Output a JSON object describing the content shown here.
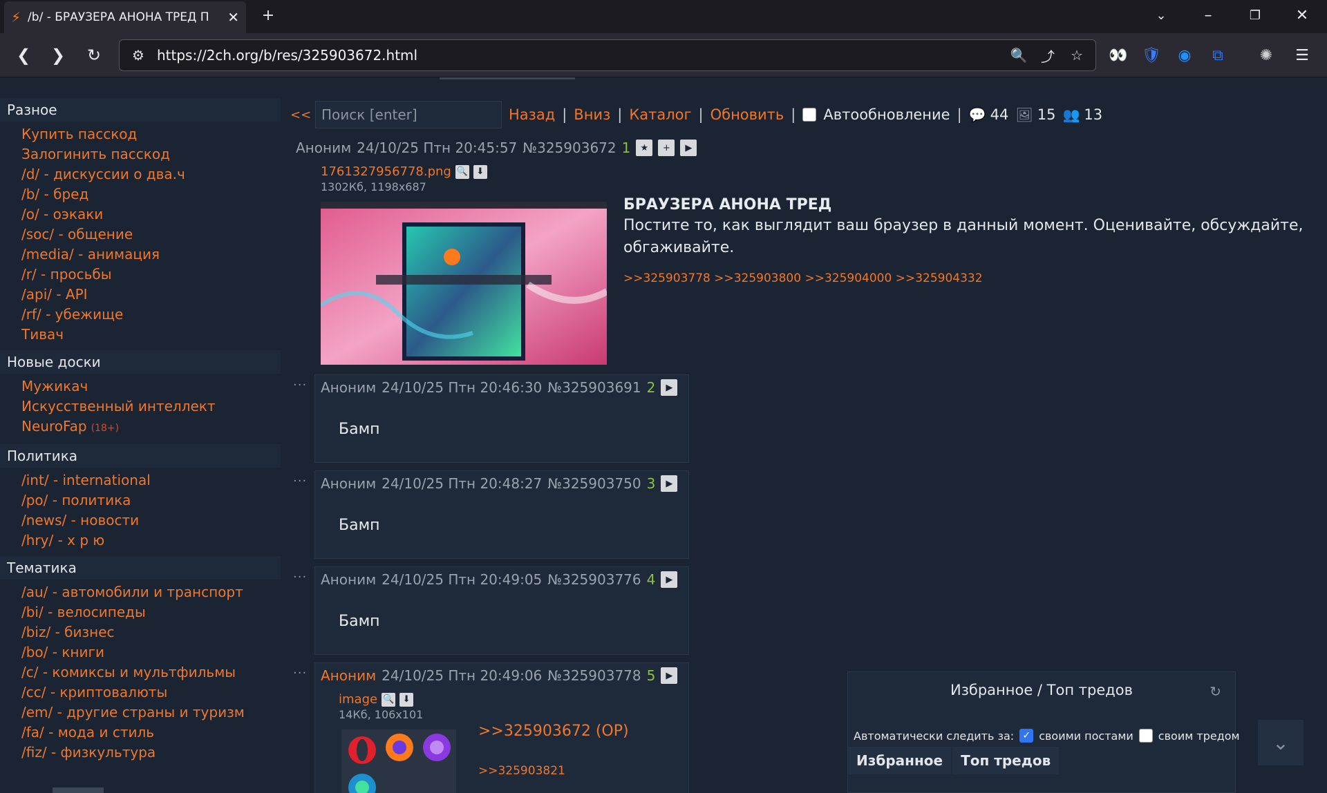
{
  "browser": {
    "tab_title": "/b/ - БРАУЗЕРА АНОНА ТРЕД П",
    "url": "https://2ch.org/b/res/325903672.html"
  },
  "sidebar": [
    {
      "title": "Разное",
      "items": [
        {
          "label": "Купить пасскод"
        },
        {
          "label": "Залогинить пасскод"
        },
        {
          "label": "/d/ - дискуссии о два.ч"
        },
        {
          "label": "/b/ - бред"
        },
        {
          "label": "/o/ - оэкаки"
        },
        {
          "label": "/soc/ - общение"
        },
        {
          "label": "/media/ - анимация"
        },
        {
          "label": "/r/ - просьбы"
        },
        {
          "label": "/api/ - API"
        },
        {
          "label": "/rf/ - убежище"
        },
        {
          "label": "Тивач"
        }
      ]
    },
    {
      "title": "Новые доски",
      "items": [
        {
          "label": "Мужикач"
        },
        {
          "label": "Искусственный интеллект"
        },
        {
          "label": "NeuroFap",
          "badge": "(18+)"
        }
      ]
    },
    {
      "title": "Политика",
      "items": [
        {
          "label": "/int/ - international"
        },
        {
          "label": "/po/ - политика"
        },
        {
          "label": "/news/ - новости"
        },
        {
          "label": "/hry/ - х р ю"
        }
      ]
    },
    {
      "title": "Тематика",
      "items": [
        {
          "label": "/au/ - автомобили и транспорт"
        },
        {
          "label": "/bi/ - велосипеды"
        },
        {
          "label": "/biz/ - бизнес"
        },
        {
          "label": "/bo/ - книги"
        },
        {
          "label": "/c/ - комиксы и мультфильмы"
        },
        {
          "label": "/cc/ - криптовалюты"
        },
        {
          "label": "/em/ - другие страны и туризм"
        },
        {
          "label": "/fa/ - мода и стиль"
        },
        {
          "label": "/fiz/ - физкультура"
        }
      ]
    }
  ],
  "topbar": {
    "back_arrow": "<<",
    "search_placeholder": "Поиск [enter]",
    "nav": [
      "Назад",
      "Вниз",
      "Каталог",
      "Обновить"
    ],
    "autoupdate_label": "Автообновление",
    "stats": {
      "posts": "44",
      "images": "15",
      "posters": "13"
    }
  },
  "op": {
    "name": "Аноним",
    "date": "24/10/25 Птн 20:45:57",
    "postnum": "№325903672",
    "index": "1",
    "file_name": "1761327956778.png",
    "file_meta": "1302Кб, 1198x687",
    "subject": "БРАУЗЕРА АНОНА ТРЕД",
    "text": "Постите то, как выглядит ваш браузер в данный момент. Оценивайте, обсуждайте, обгаживайте.",
    "replies": ">>325903778 >>325903800 >>325904000 >>325904332"
  },
  "replies": [
    {
      "name": "Аноним",
      "date": "24/10/25 Птн 20:46:30",
      "postnum": "№325903691",
      "index": "2",
      "text": "Бамп"
    },
    {
      "name": "Аноним",
      "date": "24/10/25 Птн 20:48:27",
      "postnum": "№325903750",
      "index": "3",
      "text": "Бамп"
    },
    {
      "name": "Аноним",
      "date": "24/10/25 Птн 20:49:05",
      "postnum": "№325903776",
      "index": "4",
      "text": "Бамп"
    },
    {
      "name": "Аноним",
      "date": "24/10/25 Птн 20:49:06",
      "postnum": "№325903778",
      "index": "5",
      "file_name": "image",
      "file_meta": "14Кб, 106x101",
      "quote": ">>325903672 (OP)",
      "quote2": ">>325903821"
    }
  ],
  "favorites": {
    "title": "Избранное / Топ тредов",
    "auto_label": "Автоматически следить за:",
    "opt_posts": "своими постами",
    "opt_thread": "своим тредом",
    "tab_fav": "Избранное",
    "tab_top": "Топ тредов"
  },
  "colors": {
    "accent": "#f0772b",
    "background": "#1a2432",
    "panel": "#1e2a3a",
    "postnum_green": "#8fbf43"
  }
}
